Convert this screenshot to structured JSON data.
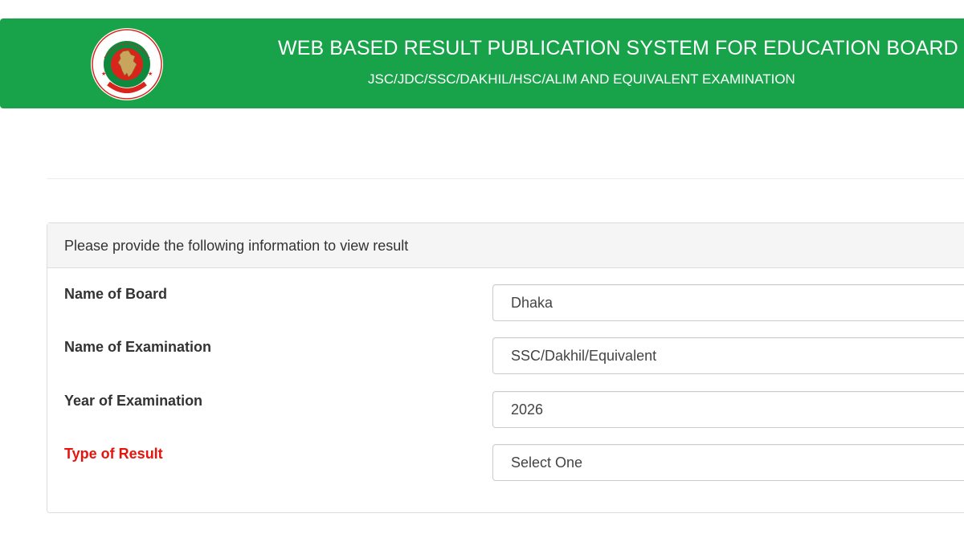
{
  "header": {
    "title": "WEB BASED RESULT PUBLICATION SYSTEM FOR EDUCATION BOARD",
    "subtitle": "JSC/JDC/SSC/DAKHIL/HSC/ALIM AND EQUIVALENT EXAMINATION",
    "logo_icon": "government-seal-icon",
    "background_color": "#18a34a"
  },
  "form": {
    "heading": "Please provide the following information to view result",
    "fields": [
      {
        "label": "Name of Board",
        "value": "Dhaka",
        "required_highlight": false
      },
      {
        "label": "Name of Examination",
        "value": "SSC/Dakhil/Equivalent",
        "required_highlight": false
      },
      {
        "label": "Year of Examination",
        "value": "2026",
        "required_highlight": false
      },
      {
        "label": "Type of Result",
        "value": "Select One",
        "required_highlight": true
      }
    ],
    "highlight_color": "#e8140c"
  }
}
